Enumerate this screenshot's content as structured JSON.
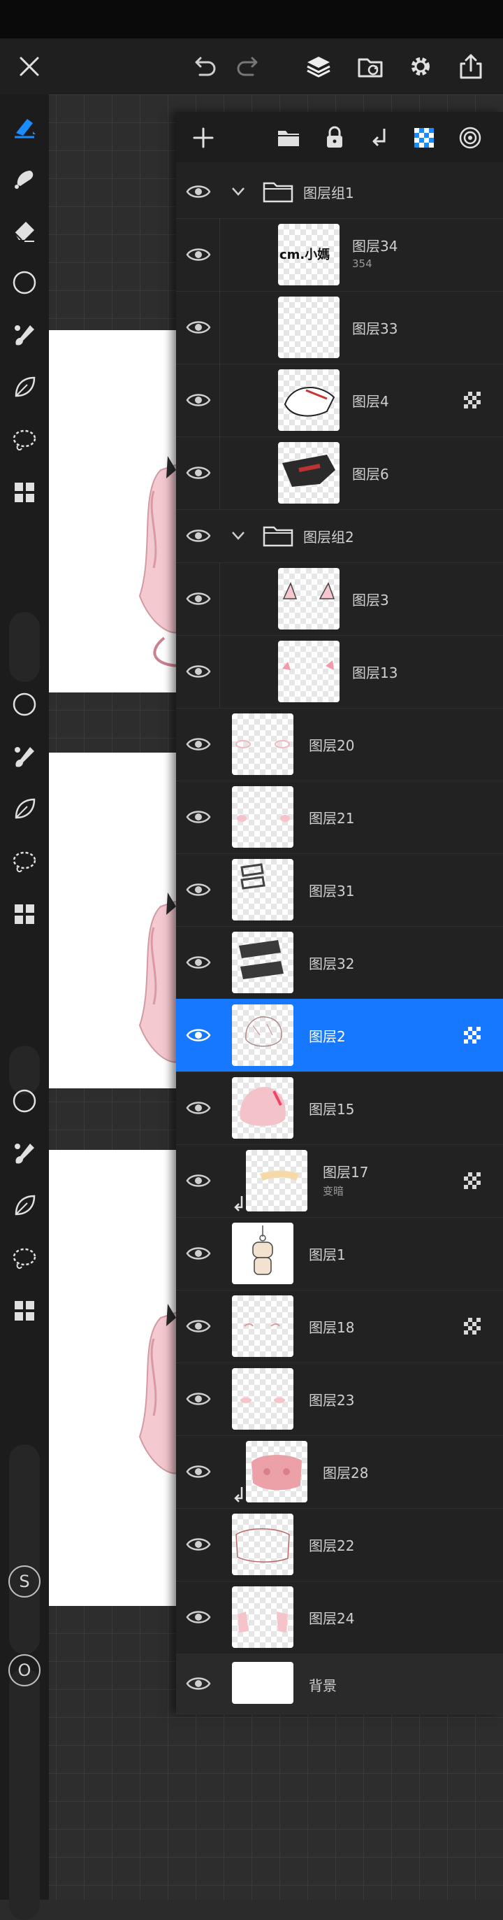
{
  "layers": {
    "group1": {
      "name": "图层组1"
    },
    "layer34": {
      "name": "图层34",
      "sub": "354",
      "thumb_text": "cm.小媽"
    },
    "layer33": {
      "name": "图层33"
    },
    "layer4": {
      "name": "图层4"
    },
    "layer6": {
      "name": "图层6"
    },
    "group2": {
      "name": "图层组2"
    },
    "layer3": {
      "name": "图层3"
    },
    "layer13": {
      "name": "图层13"
    },
    "layer20": {
      "name": "图层20"
    },
    "layer21": {
      "name": "图层21"
    },
    "layer31": {
      "name": "图层31"
    },
    "layer32": {
      "name": "图层32"
    },
    "layer2": {
      "name": "图层2"
    },
    "layer15": {
      "name": "图层15"
    },
    "layer17": {
      "name": "图层17",
      "sub": "变暗"
    },
    "layer1": {
      "name": "图层1"
    },
    "layer18": {
      "name": "图层18"
    },
    "layer23": {
      "name": "图层23"
    },
    "layer28": {
      "name": "图层28"
    },
    "layer22": {
      "name": "图层22"
    },
    "layer24": {
      "name": "图层24"
    },
    "background": {
      "name": "背景"
    }
  },
  "rail": {
    "s_label": "S",
    "o_label": "O"
  },
  "colors": {
    "selected": "#1677ff",
    "panel": "#222222",
    "accent": "#1a8cff"
  }
}
